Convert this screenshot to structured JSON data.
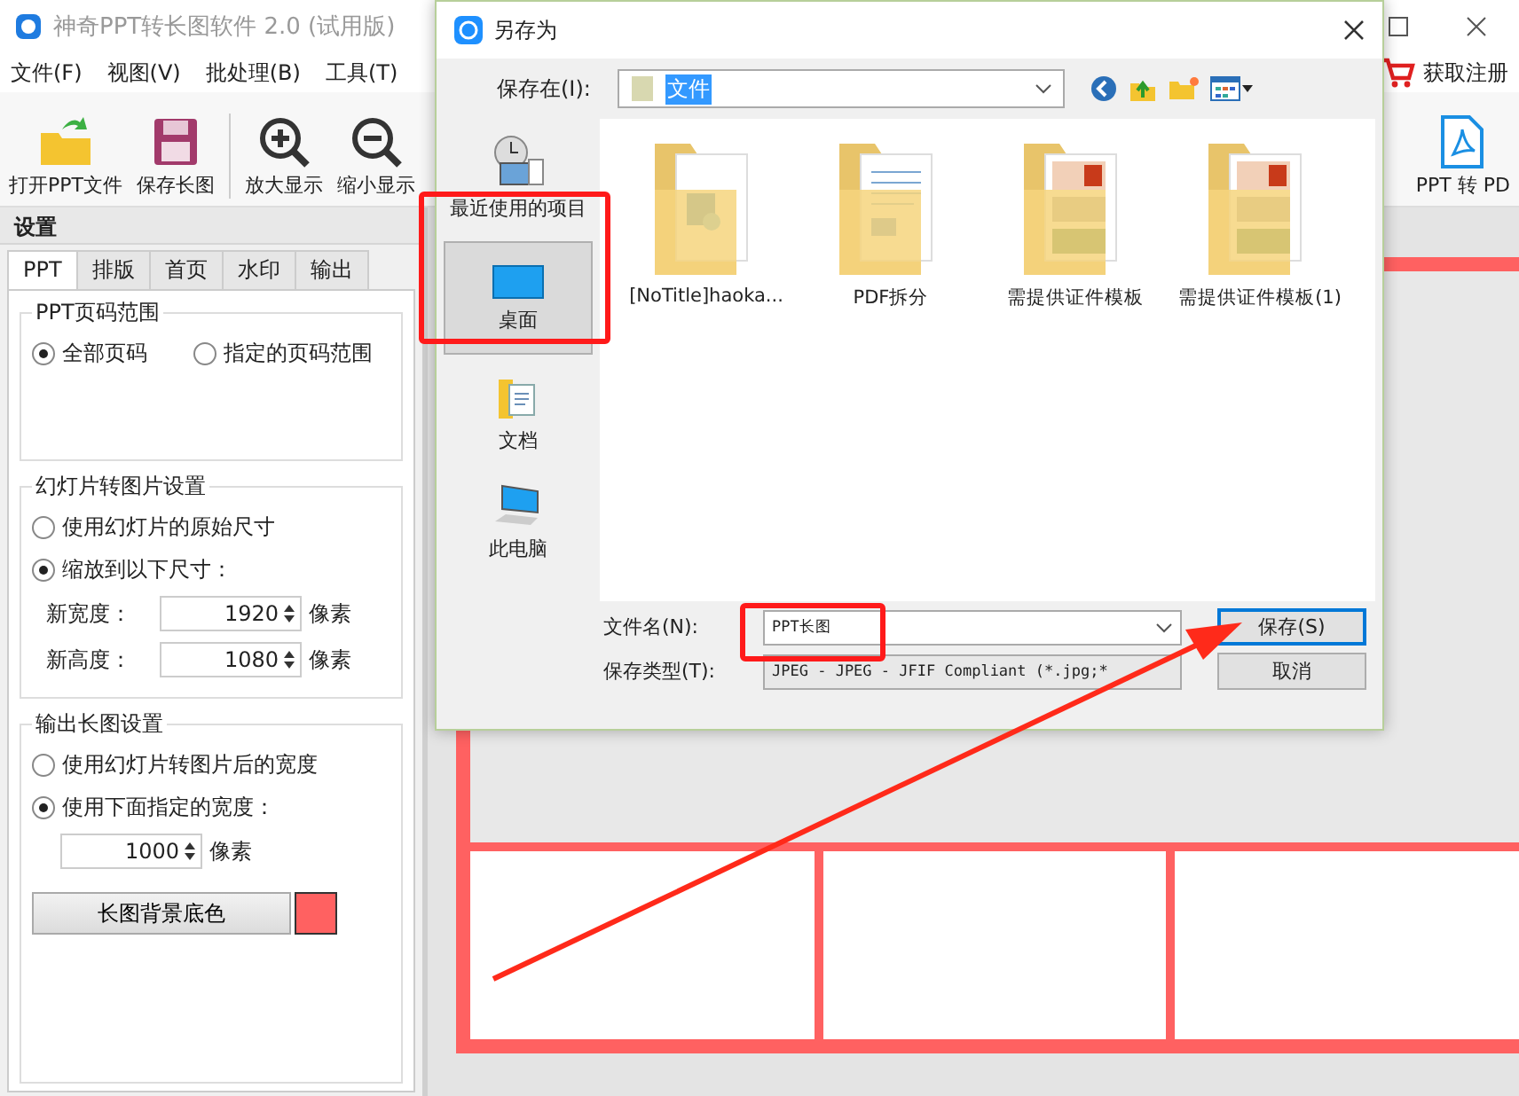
{
  "app": {
    "title": "神奇PPT转长图软件 2.0 (试用版)",
    "menu": [
      "文件(F)",
      "视图(V)",
      "批处理(B)",
      "工具(T)"
    ],
    "register": "获取注册",
    "toolbar": [
      {
        "kind": "open",
        "label": "打开PPT文件"
      },
      {
        "kind": "save",
        "label": "保存长图"
      },
      {
        "kind": "zoom-in",
        "label": "放大显示"
      },
      {
        "kind": "zoom-out",
        "label": "缩小显示"
      }
    ],
    "pdf_button": "PPT 转 PD"
  },
  "settings": {
    "title": "设置",
    "tabs": [
      {
        "label": "PPT",
        "selected": true
      },
      {
        "label": "排版",
        "selected": false
      },
      {
        "label": "首页",
        "selected": false
      },
      {
        "label": "水印",
        "selected": false
      },
      {
        "label": "输出",
        "selected": false
      }
    ],
    "page_range": {
      "title": "PPT页码范围",
      "options": [
        {
          "label": "全部页码",
          "selected": true
        },
        {
          "label": "指定的页码范围",
          "selected": false
        }
      ]
    },
    "slide_image": {
      "title": "幻灯片转图片设置",
      "options": [
        {
          "label": "使用幻灯片的原始尺寸",
          "selected": false
        },
        {
          "label": "缩放到以下尺寸：",
          "selected": true
        }
      ],
      "sizes": [
        {
          "label": "新宽度：",
          "value": "1920",
          "unit": "像素"
        },
        {
          "label": "新高度：",
          "value": "1080",
          "unit": "像素"
        }
      ]
    },
    "output": {
      "title": "输出长图设置",
      "options": [
        {
          "label": "使用幻灯片转图片后的宽度",
          "selected": false
        },
        {
          "label": "使用下面指定的宽度：",
          "selected": true
        }
      ],
      "width": {
        "value": "1000",
        "unit": "像素"
      },
      "color_button": "长图背景底色",
      "color": "#ff6161"
    }
  },
  "dialog": {
    "title": "另存为",
    "save_in_label": "保存在(I):",
    "save_in": "文件",
    "places": [
      {
        "kind": "recent",
        "label": "最近使用的项目",
        "selected": false
      },
      {
        "kind": "desktop",
        "label": "桌面",
        "selected": true
      },
      {
        "kind": "documents",
        "label": "文档",
        "selected": false
      },
      {
        "kind": "computer",
        "label": "此电脑",
        "selected": false
      }
    ],
    "files": [
      {
        "kind": "media",
        "name": "[NoTitle]haoka..."
      },
      {
        "kind": "docs",
        "name": "PDF拆分"
      },
      {
        "kind": "cards",
        "name": "需提供证件模板"
      },
      {
        "kind": "cards",
        "name": "需提供证件模板(1)"
      }
    ],
    "filename_label": "文件名(N):",
    "filename": "PPT长图",
    "type_label": "保存类型(T):",
    "type": "JPEG - JPEG - JFIF Compliant (*.jpg;*",
    "buttons": [
      {
        "label": "保存(S)",
        "primary": true
      },
      {
        "label": "取消",
        "primary": false
      }
    ]
  }
}
